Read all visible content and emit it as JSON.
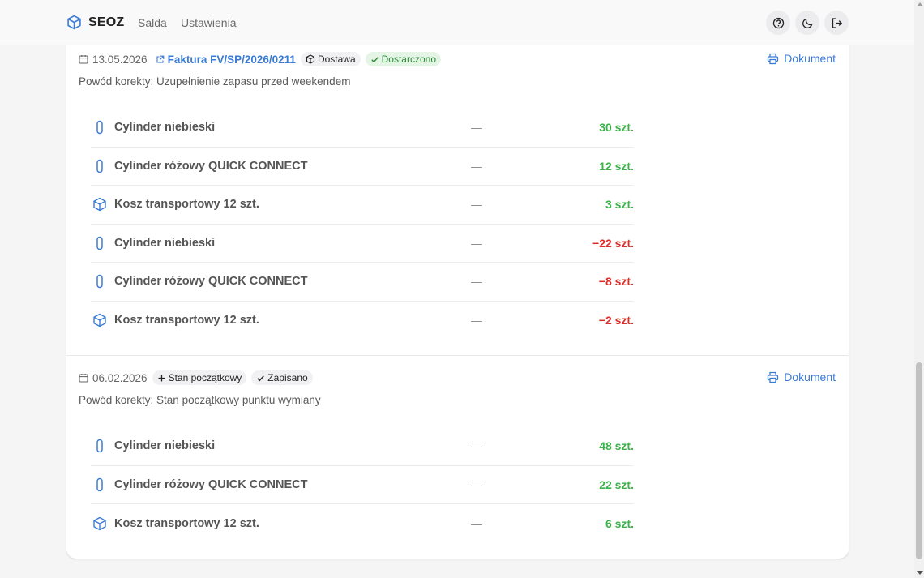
{
  "header": {
    "brand": "SEOZ",
    "nav": [
      "Salda",
      "Ustawienia"
    ]
  },
  "entries": [
    {
      "date": "13.05.2026",
      "invoice": "Faktura FV/SP/2026/0211",
      "type_badge": "Dostawa",
      "status_badge": "Dostarczono",
      "document_label": "Dokument",
      "reason": "Powód korekty: Uzupełnienie zapasu przed weekendem",
      "items": [
        {
          "name": "Cylinder niebieski",
          "dash": "—",
          "qty": "30 szt."
        },
        {
          "name": "Cylinder różowy QUICK CONNECT",
          "dash": "—",
          "qty": "12 szt."
        },
        {
          "name": "Kosz transportowy 12 szt.",
          "dash": "—",
          "qty": "3 szt."
        },
        {
          "name": "Cylinder niebieski",
          "dash": "—",
          "qty": "−22 szt."
        },
        {
          "name": "Cylinder różowy QUICK CONNECT",
          "dash": "—",
          "qty": "−8 szt."
        },
        {
          "name": "Kosz transportowy 12 szt.",
          "dash": "—",
          "qty": "−2 szt."
        }
      ]
    },
    {
      "date": "06.02.2026",
      "type_badge": "Stan początkowy",
      "status_badge": "Zapisano",
      "document_label": "Dokument",
      "reason": "Powód korekty: Stan początkowy punktu wymiany",
      "items": [
        {
          "name": "Cylinder niebieski",
          "dash": "—",
          "qty": "48 szt."
        },
        {
          "name": "Cylinder różowy QUICK CONNECT",
          "dash": "—",
          "qty": "22 szt."
        },
        {
          "name": "Kosz transportowy 12 szt.",
          "dash": "—",
          "qty": "6 szt."
        }
      ]
    }
  ],
  "colors": {
    "accent": "#3a7bd5",
    "positive": "#3bb14a",
    "negative": "#e02b2b"
  }
}
